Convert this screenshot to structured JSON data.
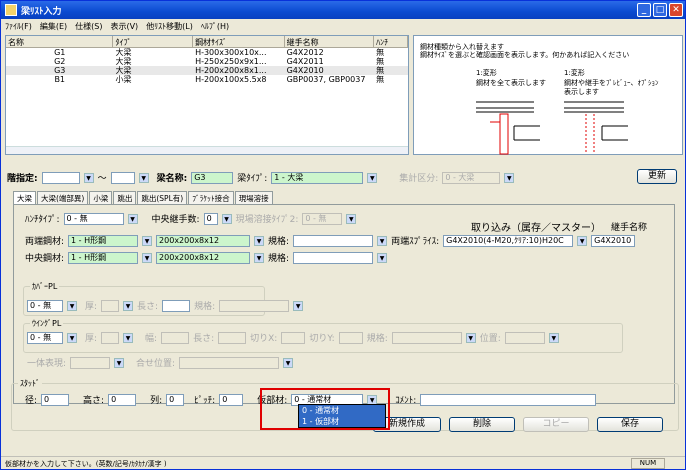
{
  "window": {
    "title": "梁ﾘｽﾄ入力"
  },
  "menu": [
    "ﾌｧｲﾙ(F)",
    "編集(E)",
    "仕様(S)",
    "表示(V)",
    "他ﾘｽﾄ移動(L)",
    "ﾍﾙﾌﾟ(H)"
  ],
  "grid": {
    "headers": [
      "名称",
      "ﾀｲﾌﾟ",
      "鋼材ｻｲｽﾞ",
      "継手名称",
      "ﾊﾝﾁ"
    ],
    "rows": [
      [
        "G1",
        "大梁",
        "H-300x300x10x...",
        "G4X2012",
        "無"
      ],
      [
        "G2",
        "大梁",
        "H-250x250x9x1...",
        "G4X2011",
        "無"
      ],
      [
        "G3",
        "大梁",
        "H-200x200x8x1...",
        "G4X2010",
        "無"
      ],
      [
        "B1",
        "小梁",
        "H-200x100x5.5x8",
        "GBP0037, GBP0037",
        "無"
      ]
    ]
  },
  "preview": {
    "line1": "鋼材種類から入れ替えます",
    "line2": "鋼材ｻｲｽﾞを選ぶと確認画面を表示します。何かあれば記入ください",
    "left_label": "1:変形",
    "left_desc": "鋼材を全て表示します",
    "right_label": "1:変形",
    "right_desc": "鋼材や継手をﾌﾟﾚﾋﾞｭｰ、ｵﾌﾟｼｮﾝ",
    "right_desc2": "表示します"
  },
  "form": {
    "floor_label": "階指定:",
    "tilde": "～",
    "beam_name_label": "梁名称:",
    "beam_name": "G3",
    "beam_type_label": "梁ﾀｲﾌﾟ:",
    "beam_type": "1 - 大梁",
    "agg_label": "集計区分:",
    "agg_value": "0 - 大梁",
    "update": "更新"
  },
  "tabs": [
    "大梁",
    "大梁(端部異)",
    "小梁",
    "跳出",
    "跳出(SPL有)",
    "ﾌﾞﾗｹｯﾄ接合",
    "現場溶接"
  ],
  "tab": {
    "haunch_label": "ﾊﾝﾁﾀｲﾌﾟ:",
    "haunch": "0 - 無",
    "center_joint_label": "中央継手数:",
    "center_joint": "0",
    "weld_label": "現場溶接ﾀｲﾌﾟ2:",
    "weld": "0 - 無",
    "import_label": "取り込み（属存／マスター）",
    "joint_name_label": "継手名称",
    "end_steel_label": "両端鋼材:",
    "end_steel": "1 - H形鋼",
    "end_size": "200x200x8x12",
    "spec_label": "規格:",
    "end_splice_label": "両端ｽﾌﾟﾗｲｽ:",
    "end_splice": "G4X2010(4-M20,ｸﾘｱ:10)H20C",
    "joint_name": "G4X2010",
    "center_steel_label": "中央鋼材:",
    "center_steel": "1 - H形鋼",
    "center_size": "200x200x8x12",
    "cover_label": "ｶﾊﾞｰPL",
    "cover": "0 - 無",
    "thick_label": "厚:",
    "len_label": "長さ:",
    "wing_label": "ｳｲﾝｸﾞPL",
    "wing": "0 - 無",
    "width_label": "幅:",
    "cutx_label": "切りX:",
    "cuty_label": "切りY:",
    "pos_label": "位置:",
    "integral_label": "一体表現:",
    "align_label": "合せ位置:"
  },
  "strut": {
    "label": "ｽﾀｯﾄﾞ",
    "dia_label": "径:",
    "dia": "0",
    "height_label": "高さ:",
    "height": "0",
    "row_label": "列:",
    "row": "0",
    "pitch_label": "ﾋﾟｯﾁ:",
    "pitch": "0",
    "temp_label": "仮部材:",
    "temp": "0 - 通常材",
    "comment_label": "ｺﾒﾝﾄ:"
  },
  "popup": [
    "0 - 通常材",
    "1 - 仮部材"
  ],
  "buttons": {
    "new": "新規作成",
    "delete": "削除",
    "copy": "コピー",
    "save": "保存"
  },
  "status": {
    "text": "仮部材かを入力して下さい。(英数/記号/ｶﾀｶﾅ/漢字 )",
    "num": "NUM"
  }
}
